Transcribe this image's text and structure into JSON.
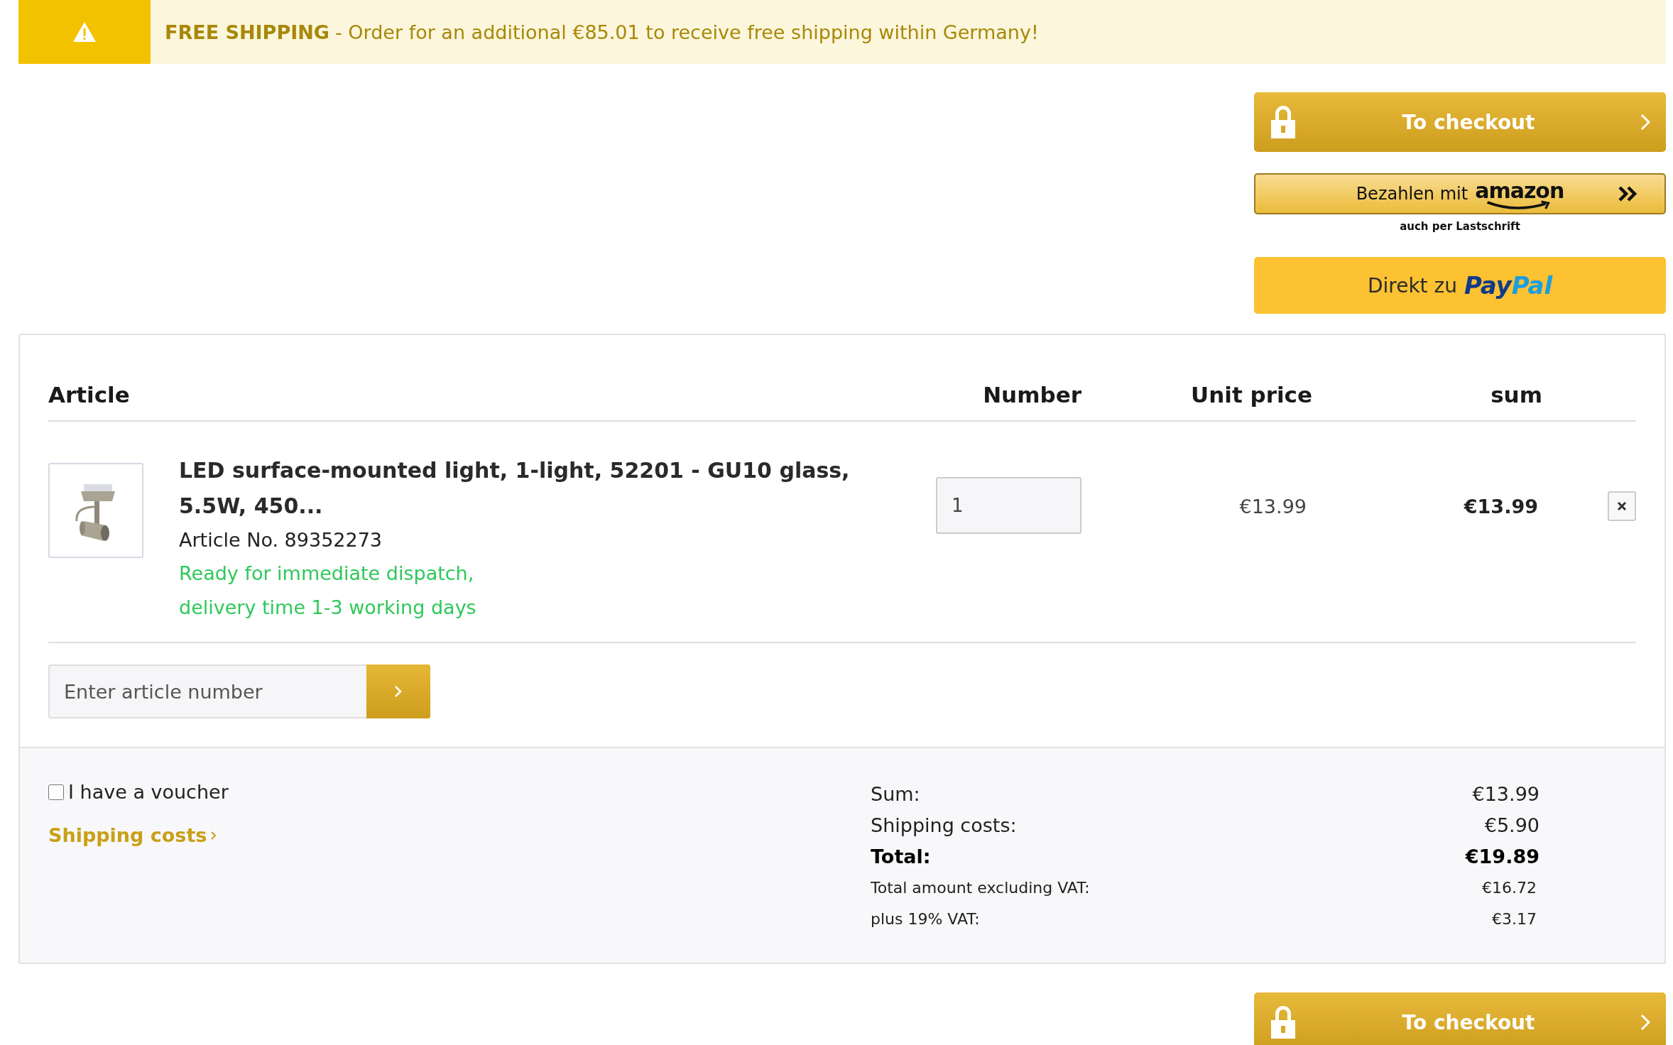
{
  "banner": {
    "title": "FREE SHIPPING",
    "message": "- Order for an additional €85.01 to receive free shipping within Germany!"
  },
  "checkout_top": {
    "label": "To checkout"
  },
  "amazon": {
    "label": "Bezahlen mit",
    "logo": "amazon",
    "note": "auch per Lastschrift"
  },
  "paypal": {
    "label": "Direkt zu",
    "logo_parts": [
      "Pay",
      "Pal"
    ]
  },
  "table": {
    "columns": [
      "Article",
      "Number",
      "Unit price",
      "sum"
    ],
    "rows": [
      {
        "title": "LED surface-mounted light, 1-light, 52201 - GU10 glass, 5.5W, 450...",
        "article_no": "Article No. 89352273",
        "availability": "Ready for immediate dispatch, delivery time 1-3 working days",
        "quantity": "1",
        "unit_price": "€13.99",
        "sum": "€13.99"
      }
    ]
  },
  "add_article": {
    "placeholder": "Enter article number"
  },
  "voucher": {
    "label": "I have a voucher",
    "checked": false
  },
  "shipping_link": "Shipping costs",
  "summary": [
    {
      "label": "Sum:",
      "value": "€13.99",
      "kind": "normal"
    },
    {
      "label": "Shipping costs:",
      "value": "€5.90",
      "kind": "normal"
    },
    {
      "label": "Total:",
      "value": "€19.89",
      "kind": "total"
    },
    {
      "label": "Total amount excluding VAT:",
      "value": "€16.72",
      "kind": "small"
    },
    {
      "label": "plus 19% VAT:",
      "value": "€3.17",
      "kind": "small"
    }
  ],
  "checkout_bottom": {
    "label": "To checkout"
  }
}
